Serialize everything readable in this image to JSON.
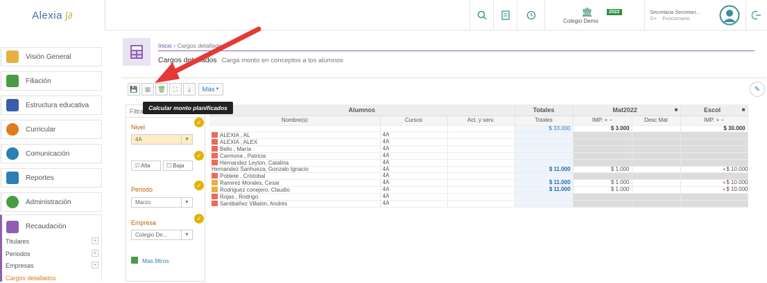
{
  "app": {
    "logo": "Alexia",
    "logo_mark": "∫∂"
  },
  "topbar": {
    "school": "Colegio Demo",
    "year": "2022",
    "user_name": "Secretaria Secretari...",
    "user_role": "Funcionario",
    "user_prefix": "G+"
  },
  "sidebar": {
    "items": [
      {
        "label": "Visión General",
        "icon": "home-icon",
        "color": "#e8b041"
      },
      {
        "label": "Filiación",
        "icon": "id-card-icon",
        "color": "#4a9c44"
      },
      {
        "label": "Estructura educativa",
        "icon": "book-icon",
        "color": "#3a5fa8"
      },
      {
        "label": "Curricular",
        "icon": "graduation-cap-icon",
        "color": "#e07b1f"
      },
      {
        "label": "Comunicación",
        "icon": "chat-icon",
        "color": "#2a7fb5"
      },
      {
        "label": "Reportes",
        "icon": "report-icon",
        "color": "#2a7fb5"
      },
      {
        "label": "Administración",
        "icon": "gears-icon",
        "color": "#4a9c44"
      },
      {
        "label": "Recaudación",
        "icon": "calculator-icon",
        "color": "#8e5fb5"
      }
    ],
    "subitems": [
      "Titulares",
      "Periodos",
      "Empresas",
      "Cargos detallados"
    ]
  },
  "breadcrumb": {
    "home": "Inicio",
    "sep": "›",
    "current": "Cargos detallados",
    "title": "Cargos detallados",
    "subtitle": "Carga monto en conceptos a los alumnos"
  },
  "toolbar": {
    "more": "Más",
    "tooltip": "Calcular monto planificados"
  },
  "filters": {
    "header": "Filtra",
    "nivel_label": "Nivel",
    "nivel_value": "4A",
    "alta": "Alta",
    "baja": "Baja",
    "periodo_label": "Periodo",
    "periodo_value": "Marzo",
    "empresa_label": "Empresa",
    "empresa_value": "Colegio De...",
    "more": "Mas filtros"
  },
  "grid": {
    "groups": {
      "alumnos": "Alumnos",
      "totales": "Totales",
      "mat": "Mat2022",
      "escol": "Escol"
    },
    "cols": {
      "nombre": "Nombre(s)",
      "cursos": "Cursos",
      "act": "Act. y serv.",
      "totales": "Totales",
      "imp": "IMP. + −",
      "desc": "Desc Mat",
      "imp2": "IMP. + −"
    },
    "summary": {
      "totales": "$ 33.000",
      "mat": "$ 3.000",
      "escol": "$ 30.000"
    },
    "rows": [
      {
        "name": "ALEXIA , AL",
        "curso": "4A",
        "total": "",
        "mat": "",
        "escol": "",
        "type": "r",
        "filled": false
      },
      {
        "name": "ALEXIA , ALEX",
        "curso": "4A",
        "total": "",
        "mat": "",
        "escol": "",
        "type": "r",
        "filled": false
      },
      {
        "name": "Bello , María",
        "curso": "4A",
        "total": "",
        "mat": "",
        "escol": "",
        "type": "r",
        "filled": false
      },
      {
        "name": "Carmona , Patricia",
        "curso": "4A",
        "total": "",
        "mat": "",
        "escol": "",
        "type": "r",
        "filled": false
      },
      {
        "name": "Hernandez Leyton, Catalina",
        "curso": "4A",
        "total": "",
        "mat": "",
        "escol": "",
        "type": "r",
        "filled": false
      },
      {
        "name": "Hernandez Sanhueza, Gonzalo Ignacio",
        "curso": "4A",
        "total": "$ 11.000",
        "mat": "$ 1.000",
        "escol": "$ 10.000",
        "type": "n",
        "filled": true
      },
      {
        "name": "Poblete , Cristobal",
        "curso": "4A",
        "total": "",
        "mat": "",
        "escol": "",
        "type": "r",
        "filled": false
      },
      {
        "name": "Ramirez Morales, Cesar",
        "curso": "4A",
        "total": "$ 11.000",
        "mat": "$ 1.000",
        "escol": "$ 10.000",
        "type": "y",
        "filled": true
      },
      {
        "name": "Rodriguez conejero, Claudio",
        "curso": "4A",
        "total": "$ 11.000",
        "mat": "$ 1.000",
        "escol": "$ 10.000",
        "type": "y",
        "filled": true
      },
      {
        "name": "Rojas , Rodrigo",
        "curso": "4A",
        "total": "",
        "mat": "",
        "escol": "",
        "type": "r",
        "filled": false
      },
      {
        "name": "Santibáñez Villalón, Andrés",
        "curso": "4A",
        "total": "",
        "mat": "",
        "escol": "",
        "type": "r",
        "filled": false
      }
    ]
  }
}
